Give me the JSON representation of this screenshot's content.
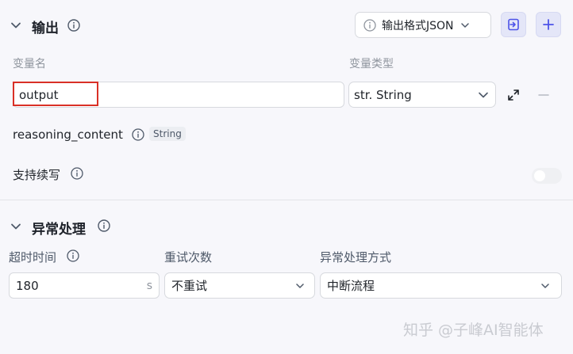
{
  "output_section": {
    "title": "输出",
    "format_button": "输出格式JSON",
    "var_name_header": "变量名",
    "var_type_header": "变量类型",
    "variable": {
      "name": "output",
      "type": "str. String"
    },
    "reasoning": {
      "name": "reasoning_content",
      "type_tag": "String"
    },
    "continue_label": "支持续写"
  },
  "exception_section": {
    "title": "异常处理",
    "timeout_label": "超时时间",
    "timeout_value": "180",
    "timeout_unit": "s",
    "retry_label": "重试次数",
    "retry_value": "不重试",
    "handling_label": "异常处理方式",
    "handling_value": "中断流程"
  },
  "watermark": "知乎 @子峰AI智能体",
  "colors": {
    "accent": "#4d53e8",
    "highlight_border": "#d93026"
  }
}
